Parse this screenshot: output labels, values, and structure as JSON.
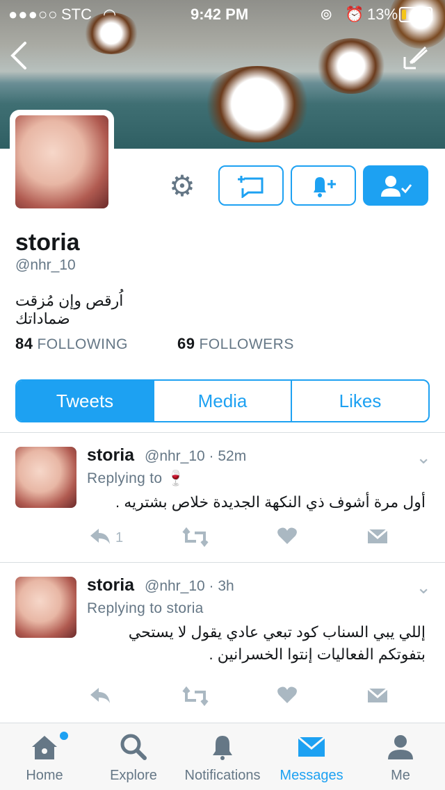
{
  "status_bar": {
    "signal": "●●●○○",
    "carrier": "STC",
    "time": "9:42 PM",
    "battery": "13%"
  },
  "header": {
    "back_label": "‹",
    "compose_icon": "compose-icon"
  },
  "profile": {
    "name": "storia",
    "handle": "@nhr_10",
    "bio": "اُرقص وإن مُزقت ضماداتك",
    "following_count": "84",
    "following_label": "FOLLOWING",
    "followers_count": "69",
    "followers_label": "FOLLOWERS"
  },
  "tabs": [
    "Tweets",
    "Media",
    "Likes"
  ],
  "tweets": [
    {
      "name": "storia",
      "meta": "@nhr_10 · 52m",
      "reply_to": "Replying to 🍷",
      "text": "أول مرة أشوف ذي النكهة الجديدة خلاص بشتريه .",
      "reply_count": "1"
    },
    {
      "name": "storia",
      "meta": "@nhr_10 · 3h",
      "reply_to": "Replying to storia",
      "text": "إللي يبي السناب كود تبعي عادي يقول لا يستحي بتفوتكم الفعاليات إنتوا الخسرانين .",
      "reply_count": ""
    }
  ],
  "bottom_nav": {
    "home": "Home",
    "explore": "Explore",
    "notifications": "Notifications",
    "messages": "Messages",
    "me": "Me"
  },
  "colors": {
    "accent": "#1da1f2",
    "muted": "#657786",
    "icon_muted": "#aab8c2"
  }
}
